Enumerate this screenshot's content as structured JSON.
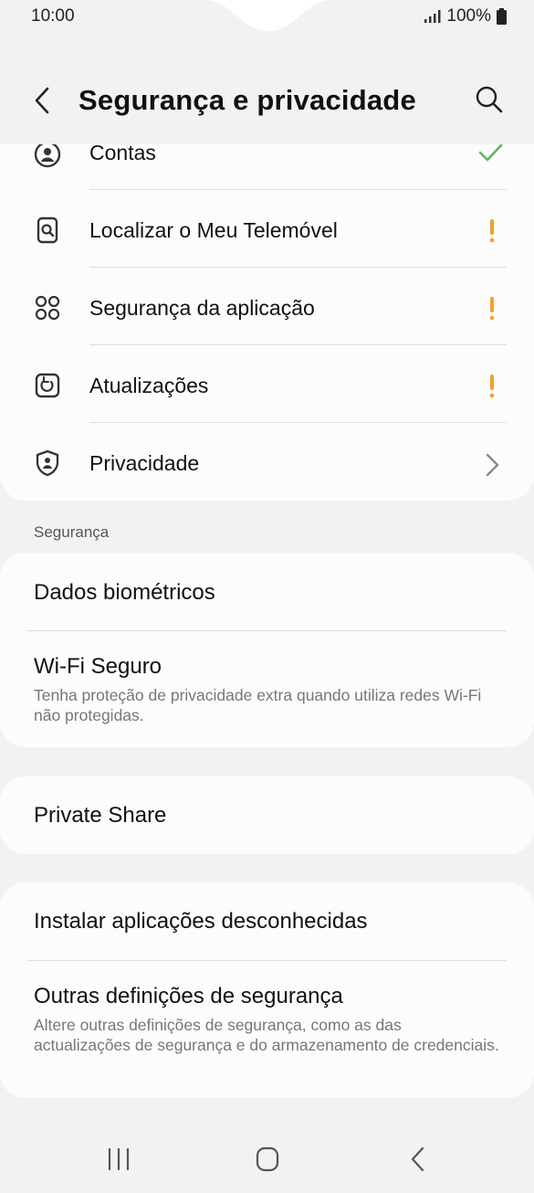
{
  "status_bar": {
    "time": "10:00",
    "battery": "100%",
    "signal_icon": "signal-bars-icon",
    "battery_icon": "battery-icon"
  },
  "header": {
    "title": "Segurança e privacidade",
    "back_icon": "chevron-left-icon",
    "search_icon": "search-icon"
  },
  "top_list": {
    "items": [
      {
        "label": "Contas",
        "icon": "account-icon",
        "status": "check",
        "status_color": "#5cb85c"
      },
      {
        "label": "Localizar o Meu Telemóvel",
        "icon": "find-phone-icon",
        "status": "warning",
        "status_color": "#f0a030"
      },
      {
        "label": "Segurança da aplicação",
        "icon": "app-grid-icon",
        "status": "warning",
        "status_color": "#f0a030"
      },
      {
        "label": "Atualizações",
        "icon": "update-icon",
        "status": "warning",
        "status_color": "#f0a030"
      },
      {
        "label": "Privacidade",
        "icon": "privacy-shield-icon",
        "status": "chevron",
        "status_color": "#888888"
      }
    ]
  },
  "security_section": {
    "header": "Segurança",
    "biometrics": {
      "title": "Dados biométricos"
    },
    "secure_wifi": {
      "title": "Wi-Fi Seguro",
      "description": "Tenha proteção de privacidade extra quando utiliza redes Wi-Fi não protegidas."
    }
  },
  "private_share": {
    "title": "Private Share"
  },
  "other_section": {
    "install_unknown": {
      "title": "Instalar aplicações desconhecidas"
    },
    "other_settings": {
      "title": "Outras definições de segurança",
      "description": "Altere outras definições de segurança, como as das actualizações de segurança e do armazenamento de credenciais."
    }
  },
  "nav": {
    "recents_icon": "recents-icon",
    "home_icon": "home-icon",
    "back_icon": "back-nav-icon"
  }
}
